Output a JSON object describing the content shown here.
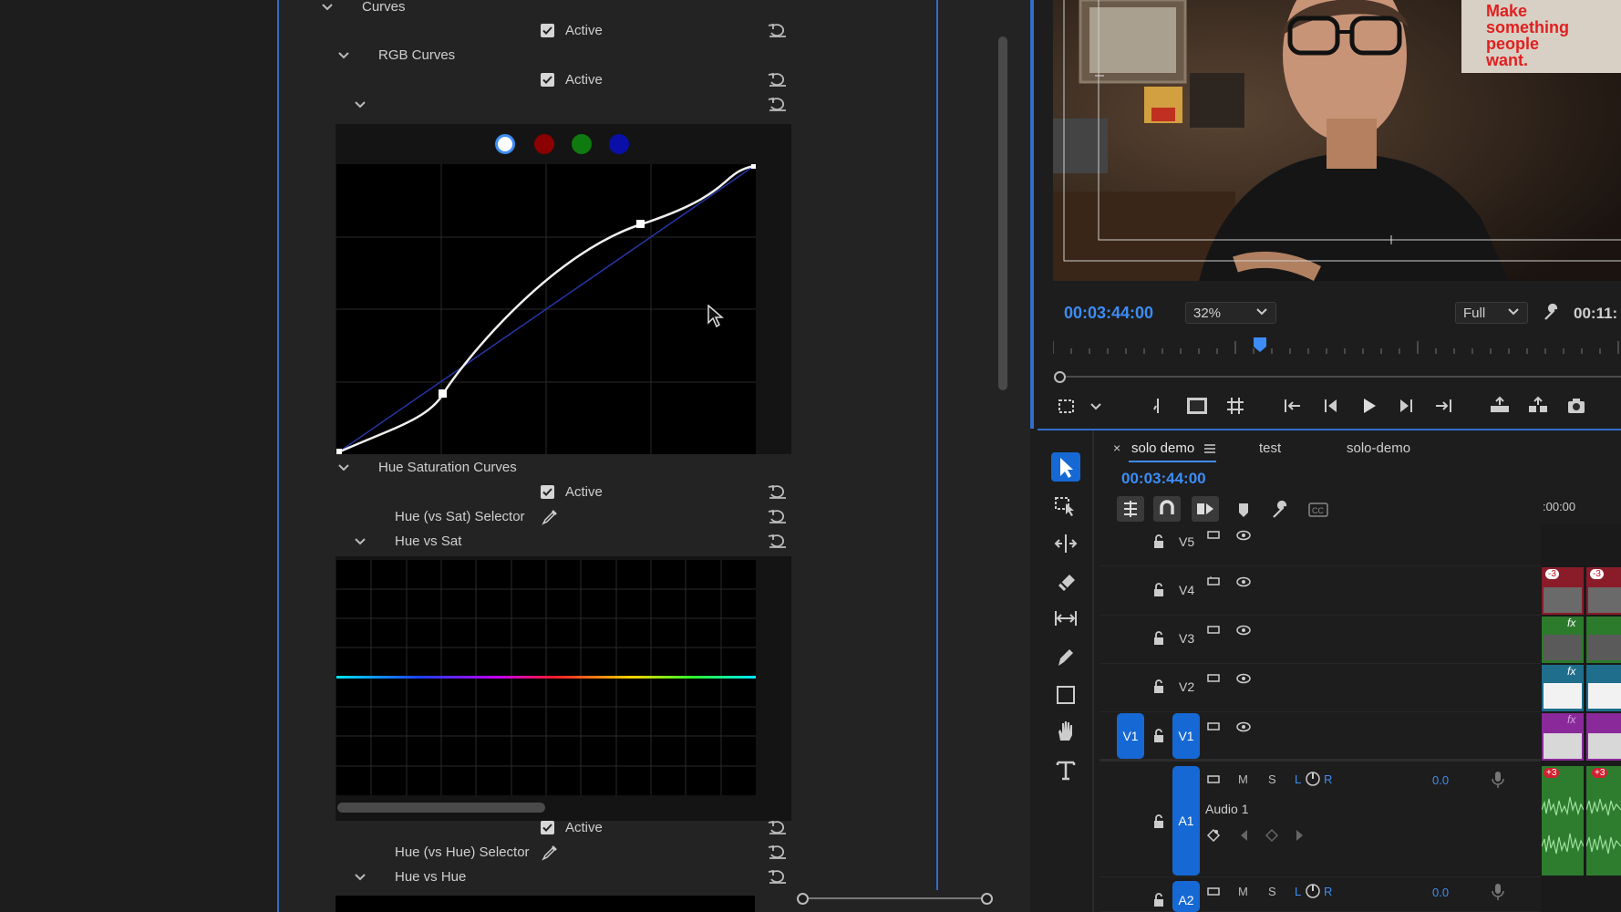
{
  "effect_controls": {
    "curves_label": "Curves",
    "rgb_curves_label": "RGB Curves",
    "hue_sat_curves_label": "Hue Saturation Curves",
    "active_label": "Active",
    "hue_vs_sat_selector_label": "Hue (vs Sat) Selector",
    "hue_vs_sat_label": "Hue vs Sat",
    "hue_vs_hue_selector_label": "Hue (vs Hue) Selector",
    "hue_vs_hue_label": "Hue vs Hue",
    "channel_dots": [
      {
        "name": "white",
        "color": "#ffffff",
        "selected": true
      },
      {
        "name": "red",
        "color": "#8b0000",
        "selected": false
      },
      {
        "name": "green",
        "color": "#0f7a0f",
        "selected": false
      },
      {
        "name": "blue",
        "color": "#0a0fa8",
        "selected": false
      }
    ]
  },
  "program_monitor": {
    "timecode": "00:03:44:00",
    "zoom": "32%",
    "quality": "Full",
    "duration": "00:11:",
    "poster_text": "Make something people want."
  },
  "timeline": {
    "tabs": [
      "solo demo",
      "test",
      "solo-demo"
    ],
    "active_tab": "solo demo",
    "timecode": "00:03:44:00",
    "ruler_start": ":00:00",
    "video_tracks": [
      "V5",
      "V4",
      "V3",
      "V2",
      "V1"
    ],
    "v1_source": "V1",
    "audio_tracks": [
      {
        "name": "A1",
        "label": "Audio 1",
        "volume": "0.0"
      },
      {
        "name": "A2",
        "label": "",
        "volume": "0.0"
      }
    ],
    "mute": "M",
    "solo": "S",
    "pan_l": "L",
    "pan_r": "R",
    "clip_badge": "-3",
    "audio_badge": "+3",
    "fx_badge": "fx"
  },
  "colors": {
    "accent": "#2f6fc9",
    "timecode": "#3d8df5",
    "track_target": "#1669d4"
  }
}
